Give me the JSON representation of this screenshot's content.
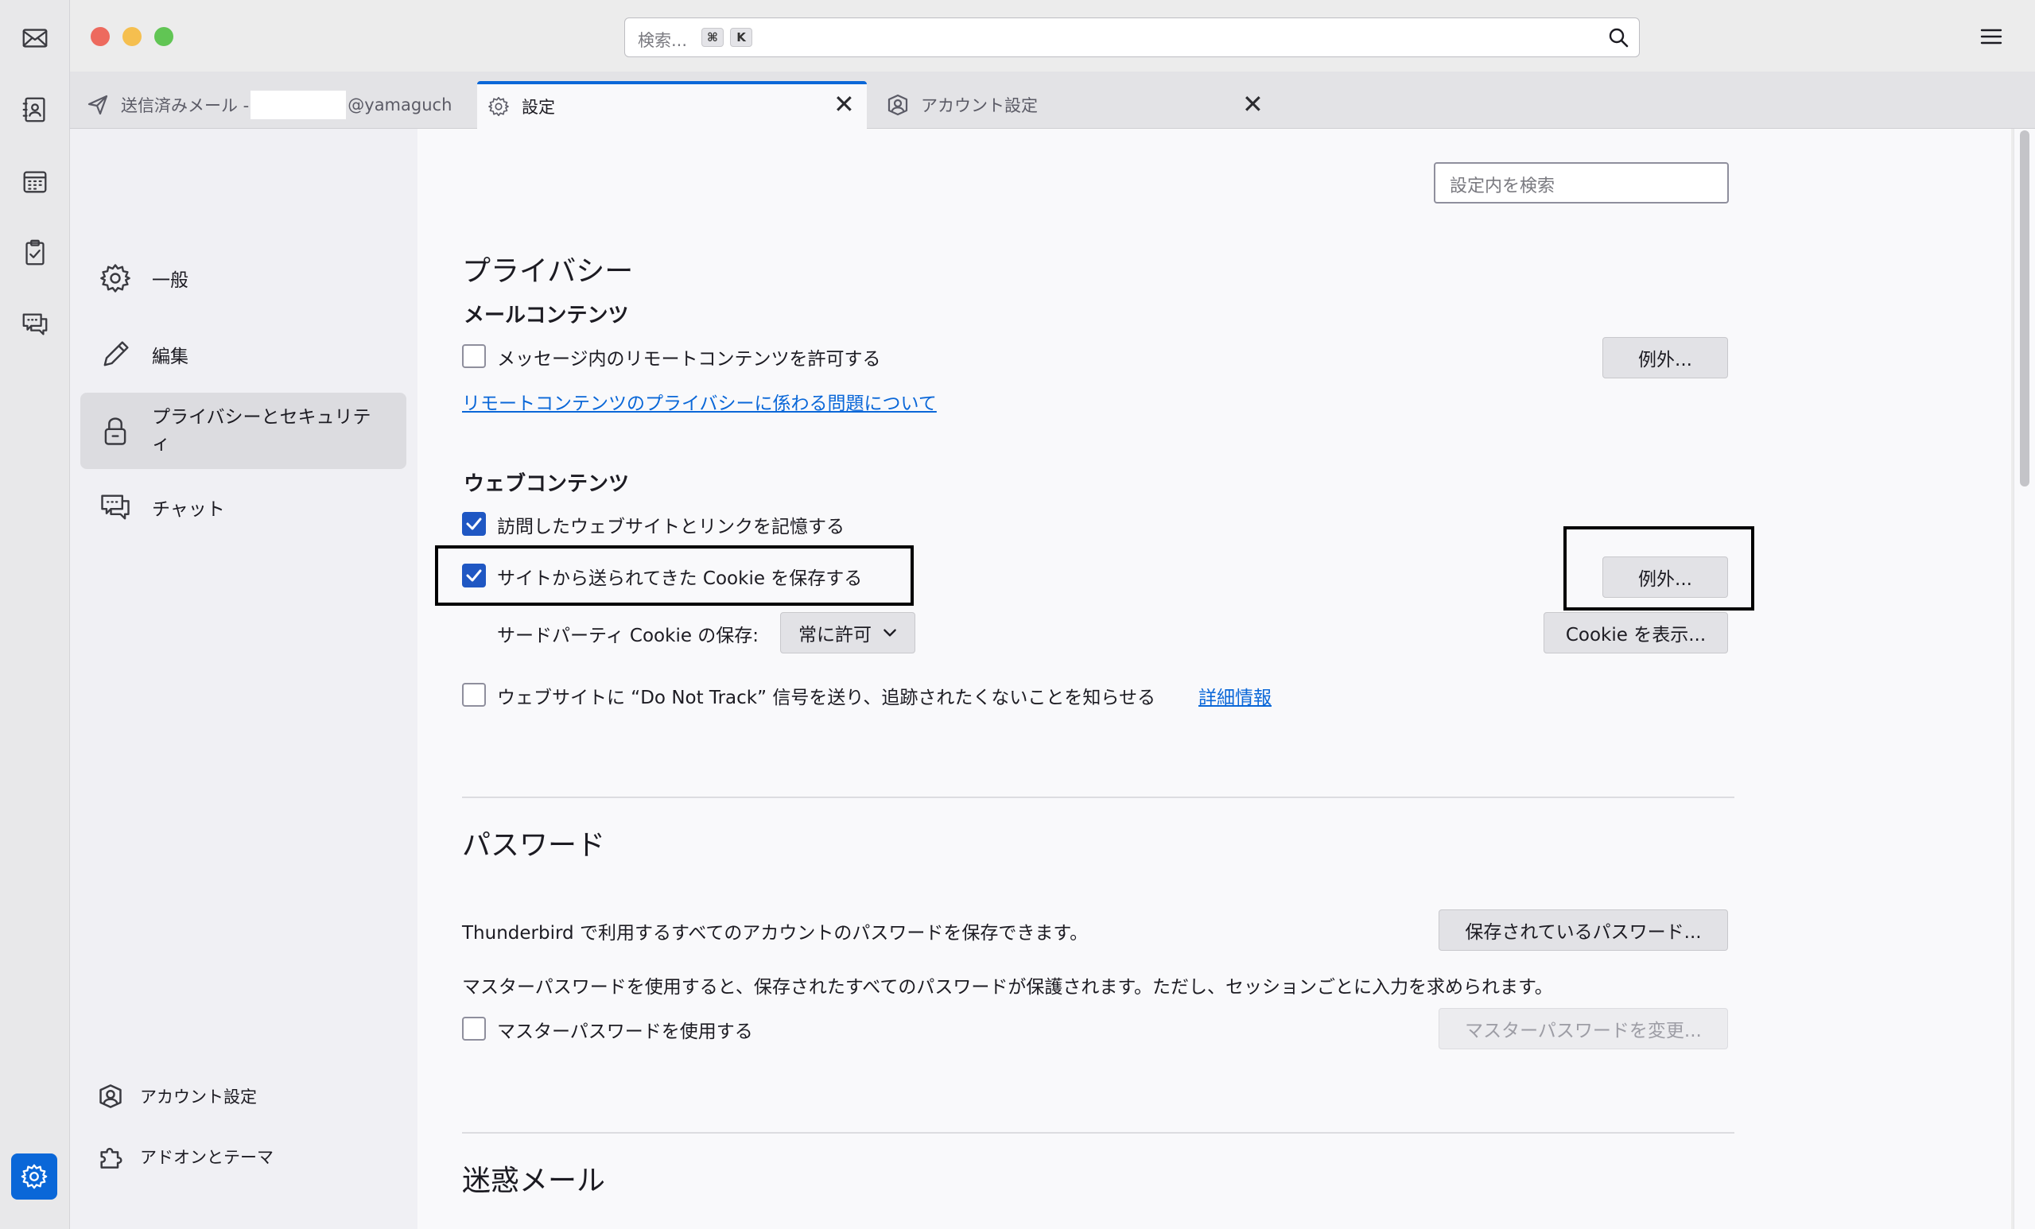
{
  "search": {
    "placeholder": "検索...",
    "key1": "⌘",
    "key2": "K"
  },
  "tabs": [
    {
      "label": "送信済みメール -",
      "suffix": "@yamaguch"
    },
    {
      "label": "設定"
    },
    {
      "label": "アカウント設定"
    }
  ],
  "nav": {
    "general": "一般",
    "compose": "編集",
    "privacy": "プライバシーとセキュリティ",
    "chat": "チャット",
    "account_settings": "アカウント設定",
    "addons": "アドオンとテーマ"
  },
  "content": {
    "search_placeholder": "設定内を検索",
    "privacy_title": "プライバシー",
    "mail_content_title": "メールコンテンツ",
    "remote_content_label": "メッセージ内のリモートコンテンツを許可する",
    "exceptions_label": "例外...",
    "remote_link": "リモートコンテンツのプライバシーに係わる問題について",
    "web_content_title": "ウェブコンテンツ",
    "remember_sites_label": "訪問したウェブサイトとリンクを記憶する",
    "accept_cookies_label": "サイトから送られてきた Cookie を保存する",
    "third_party_label": "サードパーティ Cookie の保存:",
    "third_party_value": "常に許可",
    "show_cookies_label": "Cookie を表示...",
    "dnt_label": "ウェブサイトに “Do Not Track” 信号を送り、追跡されたくないことを知らせる",
    "dnt_link": "詳細情報",
    "passwords_title": "パスワード",
    "passwords_desc": "Thunderbird で利用するすべてのアカウントのパスワードを保存できます。",
    "saved_passwords_label": "保存されているパスワード...",
    "master_desc": "マスターパスワードを使用すると、保存されたすべてのパスワードが保護されます。ただし、セッションごとに入力を求められます。",
    "use_master_label": "マスターパスワードを使用する",
    "change_master_label": "マスターパスワードを変更...",
    "junk_title": "迷惑メール"
  },
  "state": {
    "remote_content_checked": false,
    "remember_sites_checked": true,
    "accept_cookies_checked": true,
    "dnt_checked": false,
    "use_master_checked": false
  },
  "colors": {
    "accent": "#0a67d8",
    "checkbox": "#1f57c3"
  }
}
